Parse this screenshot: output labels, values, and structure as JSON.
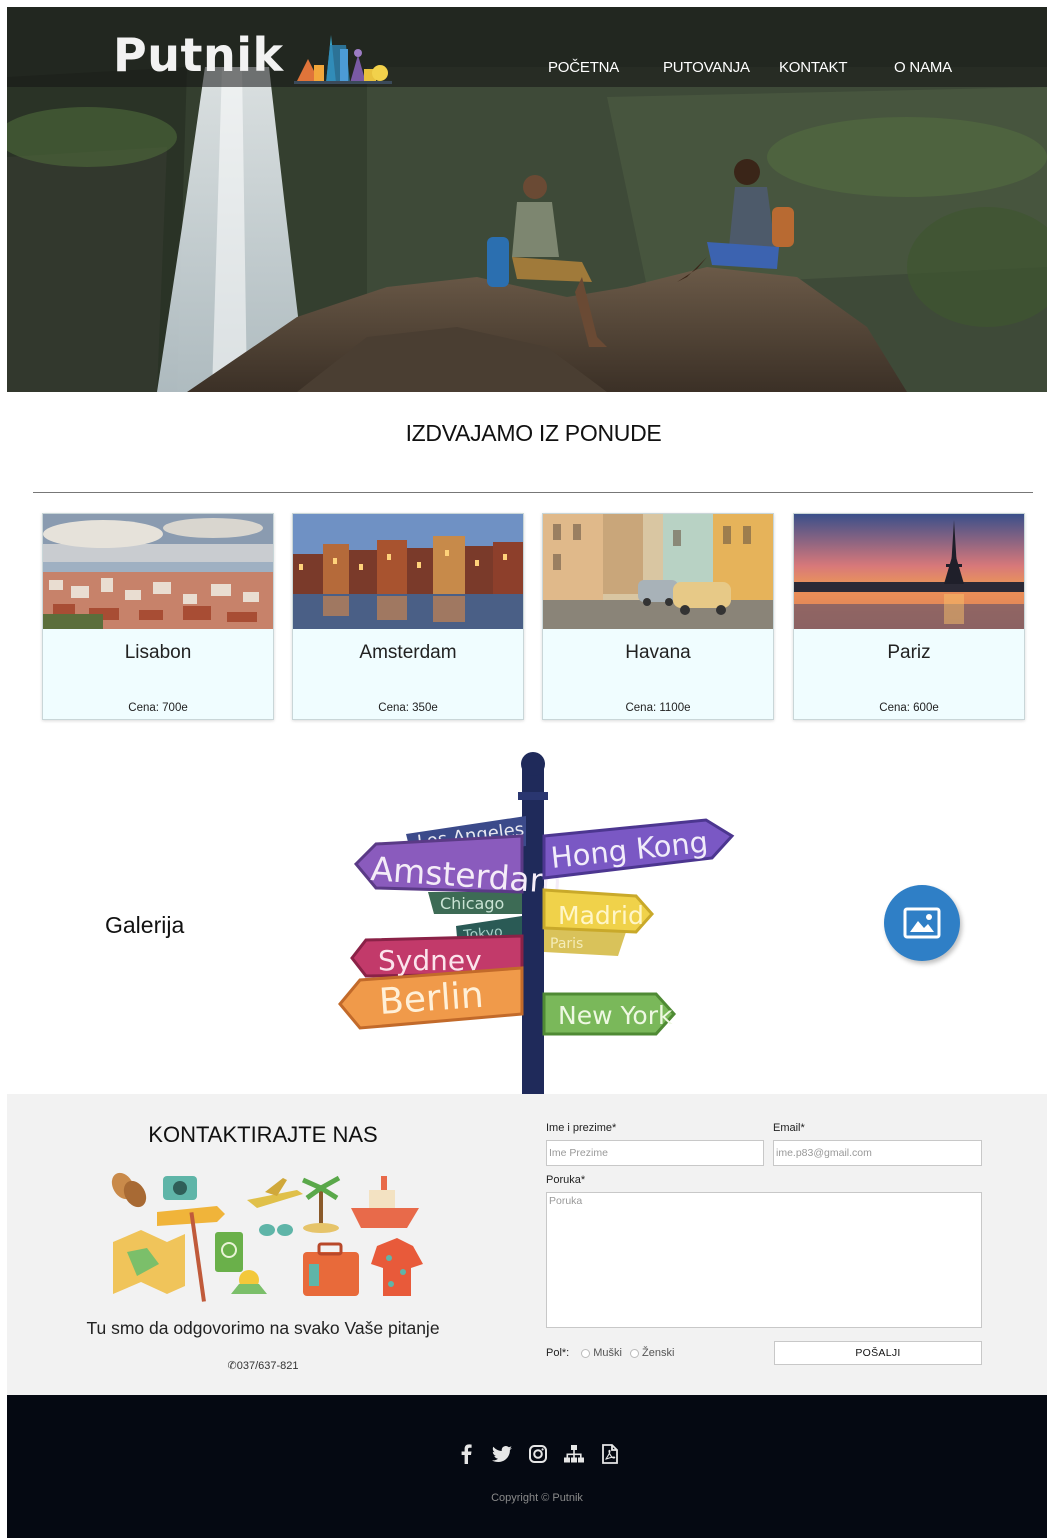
{
  "brand": {
    "name": "Putnik"
  },
  "nav": {
    "items": [
      "POČETNA",
      "PUTOVANJA",
      "KONTAKT",
      "O NAMA"
    ]
  },
  "offers": {
    "heading": "IZDVAJAMO IZ PONUDE",
    "cards": [
      {
        "city": "Lisabon",
        "price": "Cena: 700e"
      },
      {
        "city": "Amsterdam",
        "price": "Cena: 350e"
      },
      {
        "city": "Havana",
        "price": "Cena: 1100e"
      },
      {
        "city": "Pariz",
        "price": "Cena: 600e"
      }
    ]
  },
  "gallery": {
    "label": "Galerija",
    "signs": [
      "Los Angeles",
      "Hong Kong",
      "Amsterdam",
      "Chicago",
      "Madrid",
      "Tokyo",
      "Paris",
      "Sydney",
      "Berlin",
      "New York"
    ],
    "button_icon": "image-icon"
  },
  "contact": {
    "title": "KONTAKTIRAJTE NAS",
    "text": "Tu smo da odgovorimo na svako Vaše pitanje",
    "phone": "037/637-821",
    "form": {
      "name_label": "Ime i prezime*",
      "name_placeholder": "Ime Prezime",
      "email_label": "Email*",
      "email_placeholder": "ime.p83@gmail.com",
      "message_label": "Poruka*",
      "message_placeholder": "Poruka",
      "gender_label": "Pol*:",
      "gender_options": [
        "Muški",
        "Ženski"
      ],
      "submit_label": "POŠALJI"
    }
  },
  "footer": {
    "socials": [
      "facebook-icon",
      "twitter-icon",
      "instagram-icon",
      "sitemap-icon",
      "pdf-icon"
    ],
    "copyright": "Copyright © Putnik"
  },
  "colors": {
    "card_bg": "#f0fdff",
    "gallery_button": "#2f7fc6",
    "contact_bg": "#f2f2f2",
    "footer_bg": "#050912"
  }
}
